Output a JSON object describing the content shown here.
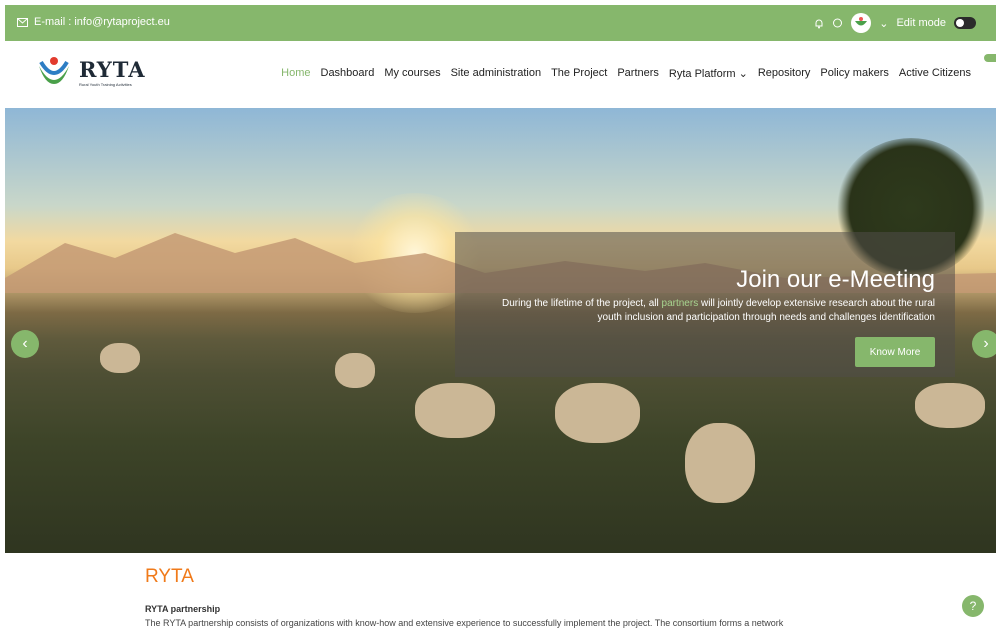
{
  "topbar": {
    "email_label": "E-mail : info@rytaproject.eu",
    "edit_mode_label": "Edit mode",
    "icons": [
      "mail-icon",
      "bell-icon",
      "chat-icon",
      "avatar",
      "chevron-down-icon",
      "toggle"
    ]
  },
  "header": {
    "logo_text": "RYTA",
    "logo_tagline": "Rural Youth Training Activities",
    "nav": [
      {
        "label": "Home",
        "active": true
      },
      {
        "label": "Dashboard"
      },
      {
        "label": "My courses"
      },
      {
        "label": "Site administration"
      },
      {
        "label": "The Project"
      },
      {
        "label": "Partners"
      },
      {
        "label": "Ryta Platform ⌄"
      },
      {
        "label": "Repository"
      },
      {
        "label": "Policy makers"
      },
      {
        "label": "Active Citizens"
      }
    ]
  },
  "hero": {
    "title": "Join our e-Meeting",
    "text_before": "During the lifetime of the project, all ",
    "text_highlight": "partners",
    "text_after": " will jointly develop extensive research about the rural youth inclusion and participation through needs and challenges identification",
    "button_label": "Know More",
    "prev_label": "‹",
    "next_label": "›"
  },
  "content": {
    "heading": "RYTA",
    "subheading": "RYTA partnership",
    "paragraph": "The RYTA partnership consists of organizations with know-how and extensive experience to successfully implement the project. The consortium forms a network"
  },
  "help_label": "?",
  "colors": {
    "accent": "#86b76c",
    "heading": "#f07a1a"
  }
}
